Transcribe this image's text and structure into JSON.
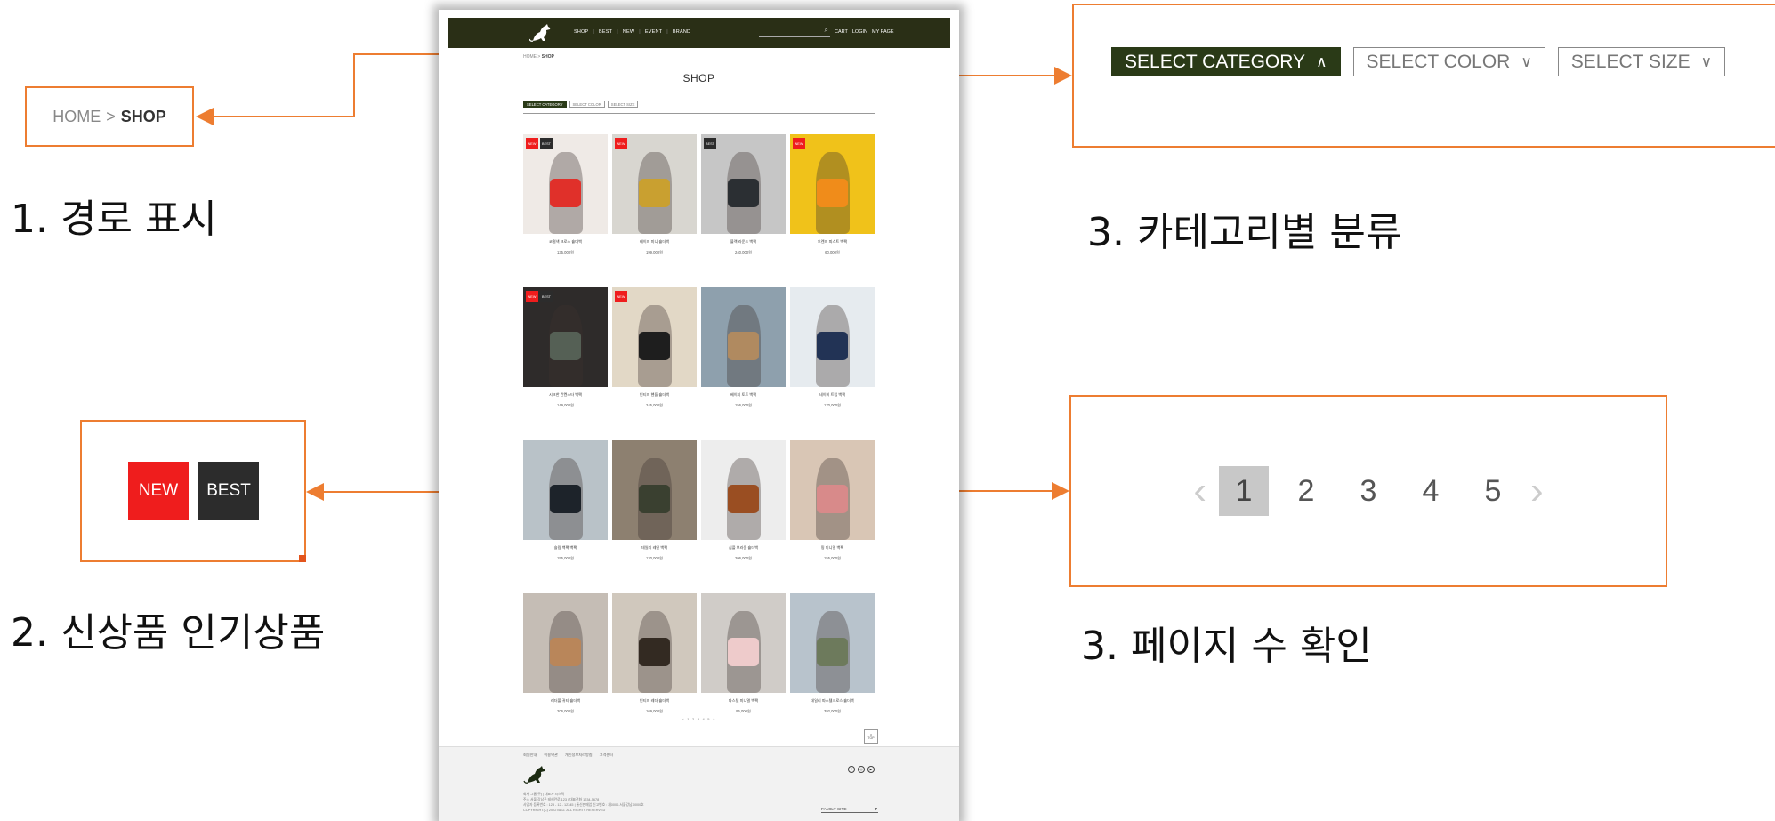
{
  "annotations": {
    "breadcrumb_zoom": {
      "home": "HOME",
      "separator": ">",
      "current": "SHOP"
    },
    "badges_zoom": {
      "new": "NEW",
      "best": "BEST"
    },
    "category_zoom": {
      "filters": [
        "SELECT CATEGORY",
        "SELECT COLOR",
        "SELECT SIZE"
      ]
    },
    "pagination_zoom": {
      "prev": "‹",
      "pages": [
        "1",
        "2",
        "3",
        "4",
        "5"
      ],
      "current": "1",
      "next": "›"
    },
    "captions": {
      "path": "1. 경로 표시",
      "badges": "2. 신상품 인기상품",
      "category": "3. 카테고리별 분류",
      "pages": "3. 페이지 수 확인"
    },
    "accent_color": "#ed7d31"
  },
  "site": {
    "nav": [
      "SHOP",
      "BEST",
      "NEW",
      "EVENT",
      "BRAND"
    ],
    "util": [
      "CART",
      "LOGIN",
      "MY PAGE"
    ],
    "breadcrumb": {
      "home": "HOME",
      "current": "SHOP"
    },
    "title": "SHOP",
    "filters": [
      "SELECT CATEGORY",
      "SELECT COLOR",
      "SELECT SIZE"
    ],
    "products": [
      {
        "name": "코럴색 크로스 숄더백",
        "price": "135,000원",
        "badges": [
          "NEW",
          "BEST"
        ],
        "color": "#e0302a",
        "bg": "#efeae6"
      },
      {
        "name": "베이지 미니 숄더백",
        "price": "199,000원",
        "badges": [
          "NEW"
        ],
        "color": "#c9a030",
        "bg": "#d8d6d0"
      },
      {
        "name": "블랙 라운드 백팩",
        "price": "240,000원",
        "badges": [
          "BEST"
        ],
        "color": "#2b2f33",
        "bg": "#c6c6c6"
      },
      {
        "name": "오렌지 피스트 백팩",
        "price": "60,000원",
        "badges": [
          "NEW"
        ],
        "color": "#f08c1a",
        "bg": "#f0c21a"
      },
      {
        "name": "시크한 칸켄스타 백팩",
        "price": "149,000원",
        "badges": [
          "NEW",
          "BEST"
        ],
        "color": "#556055",
        "bg": "#2e2b2a"
      },
      {
        "name": "빈티지 핸들 숄더백",
        "price": "245,000원",
        "badges": [
          "NEW"
        ],
        "color": "#1e1e1e",
        "bg": "#e2d8c6"
      },
      {
        "name": "베이지 토트 백팩",
        "price": "156,000원",
        "badges": [],
        "color": "#b08a60",
        "bg": "#8ea0ad"
      },
      {
        "name": "네이비 트립 백팩",
        "price": "170,000원",
        "badges": [],
        "color": "#223355",
        "bg": "#e6ebef"
      },
      {
        "name": "슬림 백팩 백팩",
        "price": "155,000원",
        "badges": [],
        "color": "#1d232a",
        "bg": "#b9c2c8"
      },
      {
        "name": "데일리 레인 백팩",
        "price": "120,000원",
        "badges": [],
        "color": "#3a4030",
        "bg": "#8d8070"
      },
      {
        "name": "심플 브라운 숄더백",
        "price": "206,000원",
        "badges": [],
        "color": "#9a4e22",
        "bg": "#ededed"
      },
      {
        "name": "핑 미니멀 백팩",
        "price": "155,000원",
        "badges": [],
        "color": "#d88a8a",
        "bg": "#d9c6b5"
      },
      {
        "name": "레더볼 귀티 숄더백",
        "price": "206,000원",
        "badges": [],
        "color": "#b9865a",
        "bg": "#c5bdb5"
      },
      {
        "name": "빈티지 레더 숄더백",
        "price": "169,000원",
        "badges": [],
        "color": "#332a22",
        "bg": "#d0c8bd"
      },
      {
        "name": "파스텔 미니멀 백팩",
        "price": "95,000원",
        "badges": [],
        "color": "#eecbcb",
        "bg": "#d0ccc8"
      },
      {
        "name": "데일리 파스텔크로스 숄더백",
        "price": "392,000원",
        "badges": [],
        "color": "#6d7a5c",
        "bg": "#b8c3cc"
      }
    ],
    "pagination": "< 1 2 3 4 5 >",
    "top_label": "TOP",
    "footer": {
      "links": [
        "회원안내",
        "이용약관",
        "개인정보처리방침",
        "고객센터"
      ],
      "info_lines": [
        "회사 그룹(주) | 대표자 시스텍",
        "주소 서울 강남구 테헤란로 123 | 대표전화 1234-5678",
        "사업자 등록번호 : 123 - 12 - 12345 | 통신판매업 신고번호 : 제0000-서울강남-0000호",
        "COPYRIGHT(C) 2022 BAG. ALL RIGHTS RESERVED"
      ],
      "family_site": "FAMILY SITE"
    }
  }
}
